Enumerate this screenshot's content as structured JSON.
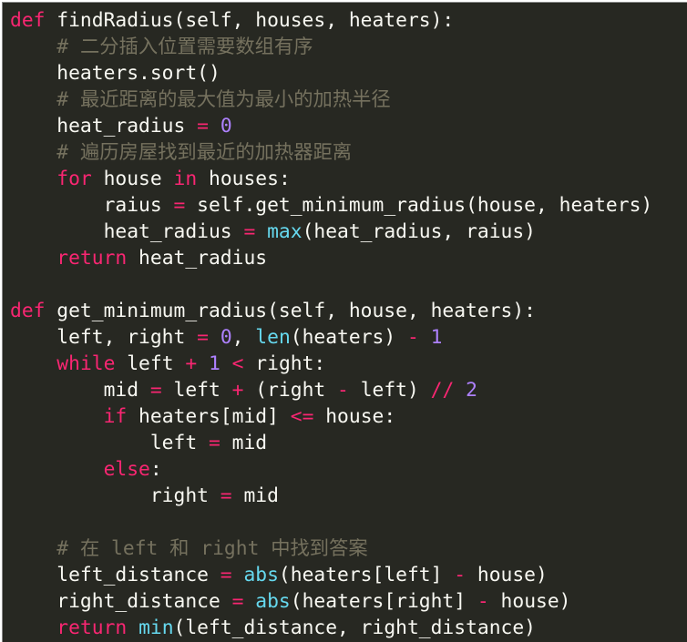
{
  "editor": {
    "background": "#272822",
    "colors": {
      "keyword": "#f92672",
      "builtin": "#66d9ef",
      "number": "#ae81ff",
      "comment": "#75715e",
      "text": "#f8f8f2"
    }
  },
  "lines": [
    [
      [
        "kw",
        "def"
      ],
      [
        "ident",
        " findRadius(self, houses, heaters):"
      ]
    ],
    [
      [
        "ident",
        "    "
      ],
      [
        "cm",
        "# 二分插入位置需要数组有序"
      ]
    ],
    [
      [
        "ident",
        "    heaters.sort()"
      ]
    ],
    [
      [
        "ident",
        "    "
      ],
      [
        "cm",
        "# 最近距离的最大值为最小的加热半径"
      ]
    ],
    [
      [
        "ident",
        "    heat_radius "
      ],
      [
        "op",
        "="
      ],
      [
        "ident",
        " "
      ],
      [
        "num",
        "0"
      ]
    ],
    [
      [
        "ident",
        "    "
      ],
      [
        "cm",
        "# 遍历房屋找到最近的加热器距离"
      ]
    ],
    [
      [
        "ident",
        "    "
      ],
      [
        "kw",
        "for"
      ],
      [
        "ident",
        " house "
      ],
      [
        "kw",
        "in"
      ],
      [
        "ident",
        " houses:"
      ]
    ],
    [
      [
        "ident",
        "        raius "
      ],
      [
        "op",
        "="
      ],
      [
        "ident",
        " self.get_minimum_radius(house, heaters)"
      ]
    ],
    [
      [
        "ident",
        "        heat_radius "
      ],
      [
        "op",
        "="
      ],
      [
        "ident",
        " "
      ],
      [
        "bi",
        "max"
      ],
      [
        "ident",
        "(heat_radius, raius)"
      ]
    ],
    [
      [
        "ident",
        "    "
      ],
      [
        "kw",
        "return"
      ],
      [
        "ident",
        " heat_radius"
      ]
    ],
    [],
    [
      [
        "kw",
        "def"
      ],
      [
        "ident",
        " get_minimum_radius(self, house, heaters):"
      ]
    ],
    [
      [
        "ident",
        "    left, right "
      ],
      [
        "op",
        "="
      ],
      [
        "ident",
        " "
      ],
      [
        "num",
        "0"
      ],
      [
        "ident",
        ", "
      ],
      [
        "bi",
        "len"
      ],
      [
        "ident",
        "(heaters) "
      ],
      [
        "op",
        "-"
      ],
      [
        "ident",
        " "
      ],
      [
        "num",
        "1"
      ]
    ],
    [
      [
        "ident",
        "    "
      ],
      [
        "kw",
        "while"
      ],
      [
        "ident",
        " left "
      ],
      [
        "op",
        "+"
      ],
      [
        "ident",
        " "
      ],
      [
        "num",
        "1"
      ],
      [
        "ident",
        " "
      ],
      [
        "op",
        "<"
      ],
      [
        "ident",
        " right:"
      ]
    ],
    [
      [
        "ident",
        "        mid "
      ],
      [
        "op",
        "="
      ],
      [
        "ident",
        " left "
      ],
      [
        "op",
        "+"
      ],
      [
        "ident",
        " (right "
      ],
      [
        "op",
        "-"
      ],
      [
        "ident",
        " left) "
      ],
      [
        "op",
        "//"
      ],
      [
        "ident",
        " "
      ],
      [
        "num",
        "2"
      ]
    ],
    [
      [
        "ident",
        "        "
      ],
      [
        "kw",
        "if"
      ],
      [
        "ident",
        " heaters[mid] "
      ],
      [
        "op",
        "<="
      ],
      [
        "ident",
        " house:"
      ]
    ],
    [
      [
        "ident",
        "            left "
      ],
      [
        "op",
        "="
      ],
      [
        "ident",
        " mid"
      ]
    ],
    [
      [
        "ident",
        "        "
      ],
      [
        "kw",
        "else"
      ],
      [
        "ident",
        ":"
      ]
    ],
    [
      [
        "ident",
        "            right "
      ],
      [
        "op",
        "="
      ],
      [
        "ident",
        " mid"
      ]
    ],
    [],
    [
      [
        "ident",
        "    "
      ],
      [
        "cm",
        "# 在 left 和 right 中找到答案"
      ]
    ],
    [
      [
        "ident",
        "    left_distance "
      ],
      [
        "op",
        "="
      ],
      [
        "ident",
        " "
      ],
      [
        "bi",
        "abs"
      ],
      [
        "ident",
        "(heaters[left] "
      ],
      [
        "op",
        "-"
      ],
      [
        "ident",
        " house)"
      ]
    ],
    [
      [
        "ident",
        "    right_distance "
      ],
      [
        "op",
        "="
      ],
      [
        "ident",
        " "
      ],
      [
        "bi",
        "abs"
      ],
      [
        "ident",
        "(heaters[right] "
      ],
      [
        "op",
        "-"
      ],
      [
        "ident",
        " house)"
      ]
    ],
    [
      [
        "ident",
        "    "
      ],
      [
        "kw",
        "return"
      ],
      [
        "ident",
        " "
      ],
      [
        "bi",
        "min"
      ],
      [
        "ident",
        "(left_distance, right_distance)"
      ]
    ]
  ]
}
